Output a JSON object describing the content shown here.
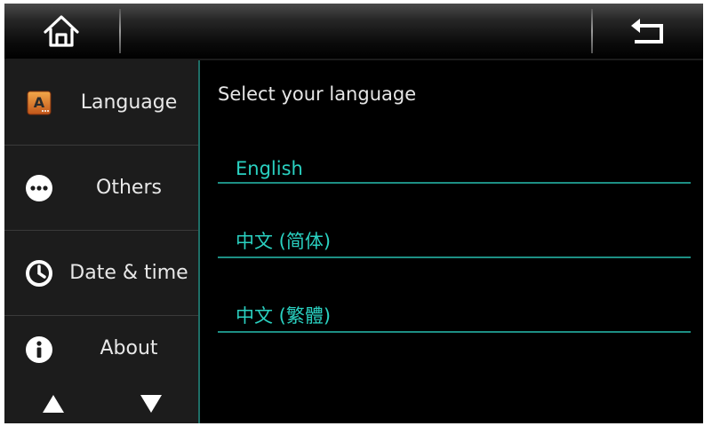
{
  "header": {
    "home_icon": "home-icon",
    "back_icon": "back-arrow-icon"
  },
  "sidebar": {
    "items": [
      {
        "label": "Language",
        "icon": "language-icon"
      },
      {
        "label": "Others",
        "icon": "more-dots-icon"
      },
      {
        "label": "Date & time",
        "icon": "clock-icon"
      },
      {
        "label": "About",
        "icon": "info-icon"
      }
    ],
    "scroll_up_icon": "triangle-up-icon",
    "scroll_down_icon": "triangle-down-icon"
  },
  "main": {
    "heading": "Select your language",
    "options": [
      {
        "label": "English"
      },
      {
        "label": "中文 (简体)"
      },
      {
        "label": "中文 (繁體)"
      }
    ]
  },
  "colors": {
    "accent": "#2ad1c1",
    "divider_accent": "#1d8f84",
    "background": "#000000",
    "sidebar_background": "#1c1c1c"
  }
}
